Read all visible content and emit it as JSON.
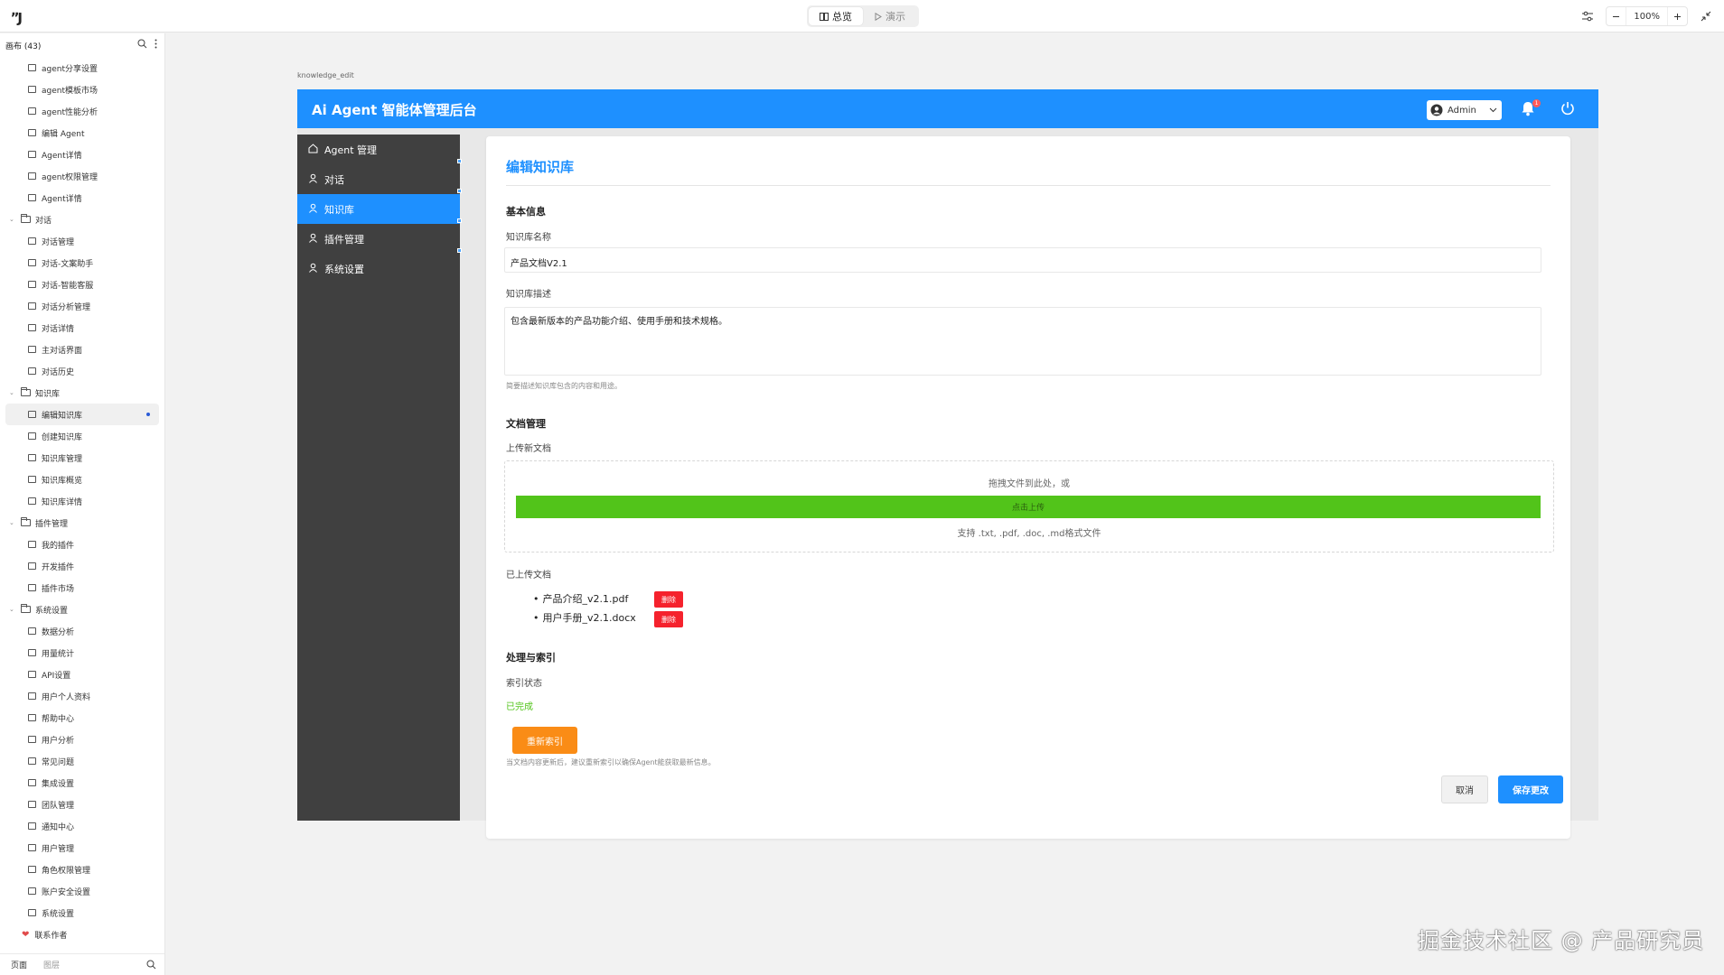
{
  "topbar": {
    "logo": "ʼʼJ",
    "mode_overview": "总览",
    "mode_demo": "演示",
    "zoom": "100%"
  },
  "outline": {
    "title": "画布 (43)",
    "items": [
      {
        "type": "page",
        "label": "agent分享设置"
      },
      {
        "type": "page",
        "label": "agent模板市场"
      },
      {
        "type": "page",
        "label": "agent性能分析"
      },
      {
        "type": "page",
        "label": "编辑 Agent"
      },
      {
        "type": "page",
        "label": "Agent详情"
      },
      {
        "type": "page",
        "label": "agent权限管理"
      },
      {
        "type": "page",
        "label": "Agent详情"
      },
      {
        "type": "folder",
        "label": "对话"
      },
      {
        "type": "page",
        "label": "对话管理"
      },
      {
        "type": "page",
        "label": "对话-文案助手"
      },
      {
        "type": "page",
        "label": "对话-智能客服"
      },
      {
        "type": "page",
        "label": "对话分析管理"
      },
      {
        "type": "page",
        "label": "对话详情"
      },
      {
        "type": "page",
        "label": "主对话界面"
      },
      {
        "type": "page",
        "label": "对话历史"
      },
      {
        "type": "folder",
        "label": "知识库"
      },
      {
        "type": "page",
        "label": "编辑知识库",
        "selected": true
      },
      {
        "type": "page",
        "label": "创建知识库"
      },
      {
        "type": "page",
        "label": "知识库管理"
      },
      {
        "type": "page",
        "label": "知识库概览"
      },
      {
        "type": "page",
        "label": "知识库详情"
      },
      {
        "type": "folder",
        "label": "插件管理"
      },
      {
        "type": "page",
        "label": "我的插件"
      },
      {
        "type": "page",
        "label": "开发插件"
      },
      {
        "type": "page",
        "label": "插件市场"
      },
      {
        "type": "folder",
        "label": "系统设置"
      },
      {
        "type": "page",
        "label": "数据分析"
      },
      {
        "type": "page",
        "label": "用量统计"
      },
      {
        "type": "page",
        "label": "API设置"
      },
      {
        "type": "page",
        "label": "用户个人资料"
      },
      {
        "type": "page",
        "label": "帮助中心"
      },
      {
        "type": "page",
        "label": "用户分析"
      },
      {
        "type": "page",
        "label": "常见问题"
      },
      {
        "type": "page",
        "label": "集成设置"
      },
      {
        "type": "page",
        "label": "团队管理"
      },
      {
        "type": "page",
        "label": "通知中心"
      },
      {
        "type": "page",
        "label": "用户管理"
      },
      {
        "type": "page",
        "label": "角色权限管理"
      },
      {
        "type": "page",
        "label": "账户安全设置"
      },
      {
        "type": "page",
        "label": "系统设置"
      },
      {
        "type": "contact",
        "label": "联系作者"
      }
    ],
    "footer_pages": "页面",
    "footer_layers": "图层"
  },
  "canvas": {
    "frame_label": "knowledge_edit"
  },
  "app": {
    "title": "Ai Agent 智能体管理后台",
    "user": "Admin",
    "notification_count": "1",
    "nav": [
      {
        "label": "Agent 管理",
        "icon": "home-icon"
      },
      {
        "label": "对话",
        "icon": "user-icon"
      },
      {
        "label": "知识库",
        "icon": "user-icon",
        "active": true
      },
      {
        "label": "插件管理",
        "icon": "user-icon"
      },
      {
        "label": "系统设置",
        "icon": "user-icon"
      }
    ]
  },
  "form": {
    "title": "编辑知识库",
    "basic_section": "基本信息",
    "name_label": "知识库名称",
    "name_value": "产品文档V2.1",
    "desc_label": "知识库描述",
    "desc_value": "包含最新版本的产品功能介绍、使用手册和技术规格。",
    "desc_hint": "简要描述知识库包含的内容和用途。",
    "doc_section": "文档管理",
    "upload_label": "上传新文档",
    "upload_drop_text": "拖拽文件到此处，或",
    "upload_button": "点击上传",
    "upload_support": "支持 .txt, .pdf, .doc, .md格式文件",
    "uploaded_label": "已上传文档",
    "files": [
      {
        "name": "产品介绍_v2.1.pdf",
        "delete_label": "删除"
      },
      {
        "name": "用户手册_v2.1.docx",
        "delete_label": "删除"
      }
    ],
    "index_section": "处理与索引",
    "index_status_label": "索引状态",
    "index_status_value": "已完成",
    "reindex_button": "重新索引",
    "reindex_hint": "当文档内容更新后，建议重新索引以确保Agent能获取最新信息。",
    "cancel_button": "取消",
    "save_button": "保存更改"
  },
  "watermark": "掘金技术社区 @ 产品研究员",
  "colors": {
    "primary": "#1e90ff",
    "success": "#52c41a",
    "danger": "#f5222d",
    "warning": "#fa8c16",
    "sidebar": "#404040"
  }
}
